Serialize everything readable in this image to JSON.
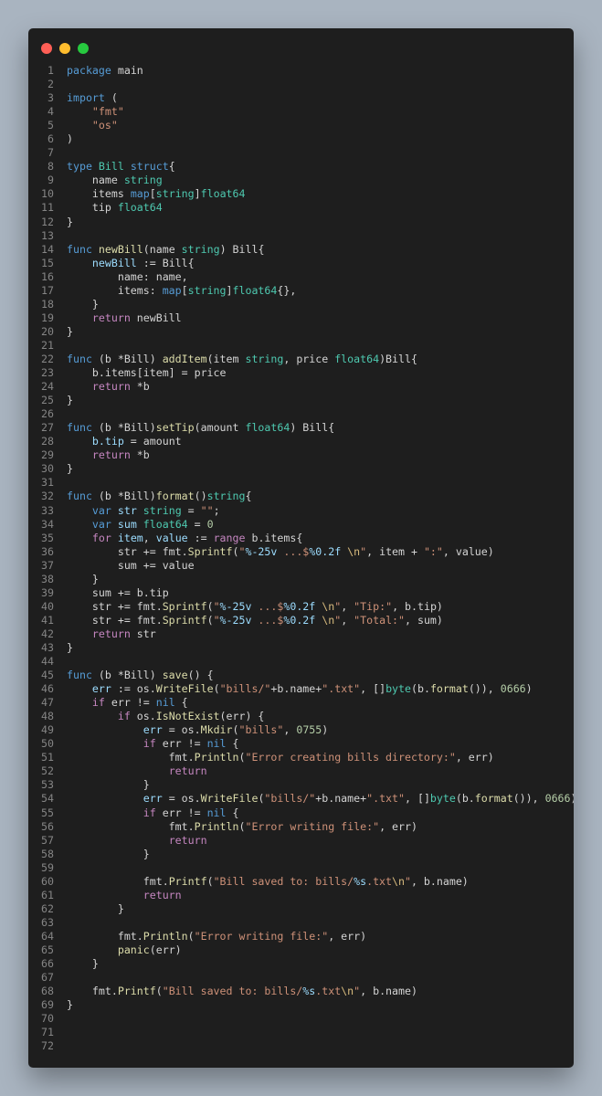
{
  "window": {
    "controls": [
      "close",
      "minimize",
      "maximize"
    ]
  },
  "colors": {
    "background": "#a9b4c0",
    "editor": "#1e1e1e",
    "keyword": "#569cd6",
    "control": "#c586c0",
    "type": "#4ec9b0",
    "function": "#dcdcaa",
    "string": "#ce9178",
    "number": "#b5cea8",
    "variable": "#9cdcfe",
    "plain": "#d4d4d4"
  },
  "code": {
    "language": "go",
    "lines": [
      [
        [
          "kw",
          "package"
        ],
        [
          "pl",
          " main"
        ]
      ],
      [],
      [
        [
          "kw",
          "import"
        ],
        [
          "pl",
          " ("
        ]
      ],
      [
        [
          "pl",
          "    "
        ],
        [
          "str",
          "\"fmt\""
        ]
      ],
      [
        [
          "pl",
          "    "
        ],
        [
          "str",
          "\"os\""
        ]
      ],
      [
        [
          "pl",
          ")"
        ]
      ],
      [],
      [
        [
          "kw",
          "type"
        ],
        [
          "pl",
          " "
        ],
        [
          "ty",
          "Bill"
        ],
        [
          "pl",
          " "
        ],
        [
          "kw",
          "struct"
        ],
        [
          "pl",
          "{"
        ]
      ],
      [
        [
          "pl",
          "    name "
        ],
        [
          "ty",
          "string"
        ]
      ],
      [
        [
          "pl",
          "    items "
        ],
        [
          "kw",
          "map"
        ],
        [
          "pl",
          "["
        ],
        [
          "ty",
          "string"
        ],
        [
          "pl",
          "]"
        ],
        [
          "ty",
          "float64"
        ]
      ],
      [
        [
          "pl",
          "    tip "
        ],
        [
          "ty",
          "float64"
        ]
      ],
      [
        [
          "pl",
          "}"
        ]
      ],
      [],
      [
        [
          "kw",
          "func"
        ],
        [
          "pl",
          " "
        ],
        [
          "fn",
          "newBill"
        ],
        [
          "pl",
          "(name "
        ],
        [
          "ty",
          "string"
        ],
        [
          "pl",
          ") Bill{"
        ]
      ],
      [
        [
          "pl",
          "    "
        ],
        [
          "var",
          "newBill"
        ],
        [
          "pl",
          " := Bill{"
        ]
      ],
      [
        [
          "pl",
          "        name: name,"
        ]
      ],
      [
        [
          "pl",
          "        items: "
        ],
        [
          "kw",
          "map"
        ],
        [
          "pl",
          "["
        ],
        [
          "ty",
          "string"
        ],
        [
          "pl",
          "]"
        ],
        [
          "ty",
          "float64"
        ],
        [
          "pl",
          "{},"
        ]
      ],
      [
        [
          "pl",
          "    }"
        ]
      ],
      [
        [
          "pl",
          "    "
        ],
        [
          "ctl",
          "return"
        ],
        [
          "pl",
          " newBill"
        ]
      ],
      [
        [
          "pl",
          "}"
        ]
      ],
      [],
      [
        [
          "kw",
          "func"
        ],
        [
          "pl",
          " (b *Bill) "
        ],
        [
          "fn",
          "addItem"
        ],
        [
          "pl",
          "(item "
        ],
        [
          "ty",
          "string"
        ],
        [
          "pl",
          ", price "
        ],
        [
          "ty",
          "float64"
        ],
        [
          "pl",
          ")Bill{"
        ]
      ],
      [
        [
          "pl",
          "    b.items[item] = price"
        ]
      ],
      [
        [
          "pl",
          "    "
        ],
        [
          "ctl",
          "return"
        ],
        [
          "pl",
          " *b"
        ]
      ],
      [
        [
          "pl",
          "}"
        ]
      ],
      [],
      [
        [
          "kw",
          "func"
        ],
        [
          "pl",
          " (b *Bill)"
        ],
        [
          "fn",
          "setTip"
        ],
        [
          "pl",
          "(amount "
        ],
        [
          "ty",
          "float64"
        ],
        [
          "pl",
          ") Bill{"
        ]
      ],
      [
        [
          "pl",
          "    "
        ],
        [
          "var",
          "b.tip"
        ],
        [
          "pl",
          " = amount"
        ]
      ],
      [
        [
          "pl",
          "    "
        ],
        [
          "ctl",
          "return"
        ],
        [
          "pl",
          " *b"
        ]
      ],
      [
        [
          "pl",
          "}"
        ]
      ],
      [],
      [
        [
          "kw",
          "func"
        ],
        [
          "pl",
          " (b *Bill)"
        ],
        [
          "fn",
          "format"
        ],
        [
          "pl",
          "()"
        ],
        [
          "ty",
          "string"
        ],
        [
          "pl",
          "{"
        ]
      ],
      [
        [
          "pl",
          "    "
        ],
        [
          "kw",
          "var"
        ],
        [
          "pl",
          " "
        ],
        [
          "var",
          "str"
        ],
        [
          "pl",
          " "
        ],
        [
          "ty",
          "string"
        ],
        [
          "pl",
          " = "
        ],
        [
          "str",
          "\"\""
        ],
        [
          "pl",
          ";"
        ]
      ],
      [
        [
          "pl",
          "    "
        ],
        [
          "kw",
          "var"
        ],
        [
          "pl",
          " "
        ],
        [
          "var",
          "sum"
        ],
        [
          "pl",
          " "
        ],
        [
          "ty",
          "float64"
        ],
        [
          "pl",
          " = "
        ],
        [
          "num",
          "0"
        ]
      ],
      [
        [
          "pl",
          "    "
        ],
        [
          "ctl",
          "for"
        ],
        [
          "pl",
          " "
        ],
        [
          "var",
          "item"
        ],
        [
          "pl",
          ", "
        ],
        [
          "var",
          "value"
        ],
        [
          "pl",
          " := "
        ],
        [
          "ctl",
          "range"
        ],
        [
          "pl",
          " b.items{"
        ]
      ],
      [
        [
          "pl",
          "        str += fmt."
        ],
        [
          "fn",
          "Sprintf"
        ],
        [
          "pl",
          "("
        ],
        [
          "str",
          "\""
        ],
        [
          "var",
          "%-25v"
        ],
        [
          "str",
          " ...$"
        ],
        [
          "var",
          "%0.2f"
        ],
        [
          "str",
          " "
        ],
        [
          "esc",
          "\\n"
        ],
        [
          "str",
          "\""
        ],
        [
          "pl",
          ", item + "
        ],
        [
          "str",
          "\":\""
        ],
        [
          "pl",
          ", value)"
        ]
      ],
      [
        [
          "pl",
          "        sum += value"
        ]
      ],
      [
        [
          "pl",
          "    }"
        ]
      ],
      [
        [
          "pl",
          "    sum += b.tip"
        ]
      ],
      [
        [
          "pl",
          "    str += fmt."
        ],
        [
          "fn",
          "Sprintf"
        ],
        [
          "pl",
          "("
        ],
        [
          "str",
          "\""
        ],
        [
          "var",
          "%-25v"
        ],
        [
          "str",
          " ...$"
        ],
        [
          "var",
          "%0.2f"
        ],
        [
          "str",
          " "
        ],
        [
          "esc",
          "\\n"
        ],
        [
          "str",
          "\""
        ],
        [
          "pl",
          ", "
        ],
        [
          "str",
          "\"Tip:\""
        ],
        [
          "pl",
          ", b.tip)"
        ]
      ],
      [
        [
          "pl",
          "    str += fmt."
        ],
        [
          "fn",
          "Sprintf"
        ],
        [
          "pl",
          "("
        ],
        [
          "str",
          "\""
        ],
        [
          "var",
          "%-25v"
        ],
        [
          "str",
          " ...$"
        ],
        [
          "var",
          "%0.2f"
        ],
        [
          "str",
          " "
        ],
        [
          "esc",
          "\\n"
        ],
        [
          "str",
          "\""
        ],
        [
          "pl",
          ", "
        ],
        [
          "str",
          "\"Total:\""
        ],
        [
          "pl",
          ", sum)"
        ]
      ],
      [
        [
          "pl",
          "    "
        ],
        [
          "ctl",
          "return"
        ],
        [
          "pl",
          " str"
        ]
      ],
      [
        [
          "pl",
          "}"
        ]
      ],
      [],
      [
        [
          "kw",
          "func"
        ],
        [
          "pl",
          " (b *Bill) "
        ],
        [
          "fn",
          "save"
        ],
        [
          "pl",
          "() {"
        ]
      ],
      [
        [
          "pl",
          "    "
        ],
        [
          "var",
          "err"
        ],
        [
          "pl",
          " := os."
        ],
        [
          "fn",
          "WriteFile"
        ],
        [
          "pl",
          "("
        ],
        [
          "str",
          "\"bills/\""
        ],
        [
          "pl",
          "+b.name+"
        ],
        [
          "str",
          "\".txt\""
        ],
        [
          "pl",
          ", []"
        ],
        [
          "ty",
          "byte"
        ],
        [
          "pl",
          "(b."
        ],
        [
          "fn",
          "format"
        ],
        [
          "pl",
          "()), "
        ],
        [
          "num",
          "0666"
        ],
        [
          "pl",
          ")"
        ]
      ],
      [
        [
          "pl",
          "    "
        ],
        [
          "ctl",
          "if"
        ],
        [
          "pl",
          " err != "
        ],
        [
          "kw",
          "nil"
        ],
        [
          "pl",
          " {"
        ]
      ],
      [
        [
          "pl",
          "        "
        ],
        [
          "ctl",
          "if"
        ],
        [
          "pl",
          " os."
        ],
        [
          "fn",
          "IsNotExist"
        ],
        [
          "pl",
          "(err) {"
        ]
      ],
      [
        [
          "pl",
          "            "
        ],
        [
          "var",
          "err"
        ],
        [
          "pl",
          " = os."
        ],
        [
          "fn",
          "Mkdir"
        ],
        [
          "pl",
          "("
        ],
        [
          "str",
          "\"bills\""
        ],
        [
          "pl",
          ", "
        ],
        [
          "num",
          "0755"
        ],
        [
          "pl",
          ")"
        ]
      ],
      [
        [
          "pl",
          "            "
        ],
        [
          "ctl",
          "if"
        ],
        [
          "pl",
          " err != "
        ],
        [
          "kw",
          "nil"
        ],
        [
          "pl",
          " {"
        ]
      ],
      [
        [
          "pl",
          "                fmt."
        ],
        [
          "fn",
          "Println"
        ],
        [
          "pl",
          "("
        ],
        [
          "str",
          "\"Error creating bills directory:\""
        ],
        [
          "pl",
          ", err)"
        ]
      ],
      [
        [
          "pl",
          "                "
        ],
        [
          "ctl",
          "return"
        ]
      ],
      [
        [
          "pl",
          "            }"
        ]
      ],
      [
        [
          "pl",
          "            "
        ],
        [
          "var",
          "err"
        ],
        [
          "pl",
          " = os."
        ],
        [
          "fn",
          "WriteFile"
        ],
        [
          "pl",
          "("
        ],
        [
          "str",
          "\"bills/\""
        ],
        [
          "pl",
          "+b.name+"
        ],
        [
          "str",
          "\".txt\""
        ],
        [
          "pl",
          ", []"
        ],
        [
          "ty",
          "byte"
        ],
        [
          "pl",
          "(b."
        ],
        [
          "fn",
          "format"
        ],
        [
          "pl",
          "()), "
        ],
        [
          "num",
          "0666"
        ],
        [
          "pl",
          ")"
        ]
      ],
      [
        [
          "pl",
          "            "
        ],
        [
          "ctl",
          "if"
        ],
        [
          "pl",
          " err != "
        ],
        [
          "kw",
          "nil"
        ],
        [
          "pl",
          " {"
        ]
      ],
      [
        [
          "pl",
          "                fmt."
        ],
        [
          "fn",
          "Println"
        ],
        [
          "pl",
          "("
        ],
        [
          "str",
          "\"Error writing file:\""
        ],
        [
          "pl",
          ", err)"
        ]
      ],
      [
        [
          "pl",
          "                "
        ],
        [
          "ctl",
          "return"
        ]
      ],
      [
        [
          "pl",
          "            }"
        ]
      ],
      [],
      [
        [
          "pl",
          "            fmt."
        ],
        [
          "fn",
          "Printf"
        ],
        [
          "pl",
          "("
        ],
        [
          "str",
          "\"Bill saved to: bills/"
        ],
        [
          "var",
          "%s"
        ],
        [
          "str",
          ".txt"
        ],
        [
          "esc",
          "\\n"
        ],
        [
          "str",
          "\""
        ],
        [
          "pl",
          ", b.name)"
        ]
      ],
      [
        [
          "pl",
          "            "
        ],
        [
          "ctl",
          "return"
        ]
      ],
      [
        [
          "pl",
          "        }"
        ]
      ],
      [],
      [
        [
          "pl",
          "        fmt."
        ],
        [
          "fn",
          "Println"
        ],
        [
          "pl",
          "("
        ],
        [
          "str",
          "\"Error writing file:\""
        ],
        [
          "pl",
          ", err)"
        ]
      ],
      [
        [
          "pl",
          "        "
        ],
        [
          "fn",
          "panic"
        ],
        [
          "pl",
          "(err)"
        ]
      ],
      [
        [
          "pl",
          "    }"
        ]
      ],
      [],
      [
        [
          "pl",
          "    fmt."
        ],
        [
          "fn",
          "Printf"
        ],
        [
          "pl",
          "("
        ],
        [
          "str",
          "\"Bill saved to: bills/"
        ],
        [
          "var",
          "%s"
        ],
        [
          "str",
          ".txt"
        ],
        [
          "esc",
          "\\n"
        ],
        [
          "str",
          "\""
        ],
        [
          "pl",
          ", b.name)"
        ]
      ],
      [
        [
          "pl",
          "}"
        ]
      ],
      [],
      [],
      []
    ]
  }
}
